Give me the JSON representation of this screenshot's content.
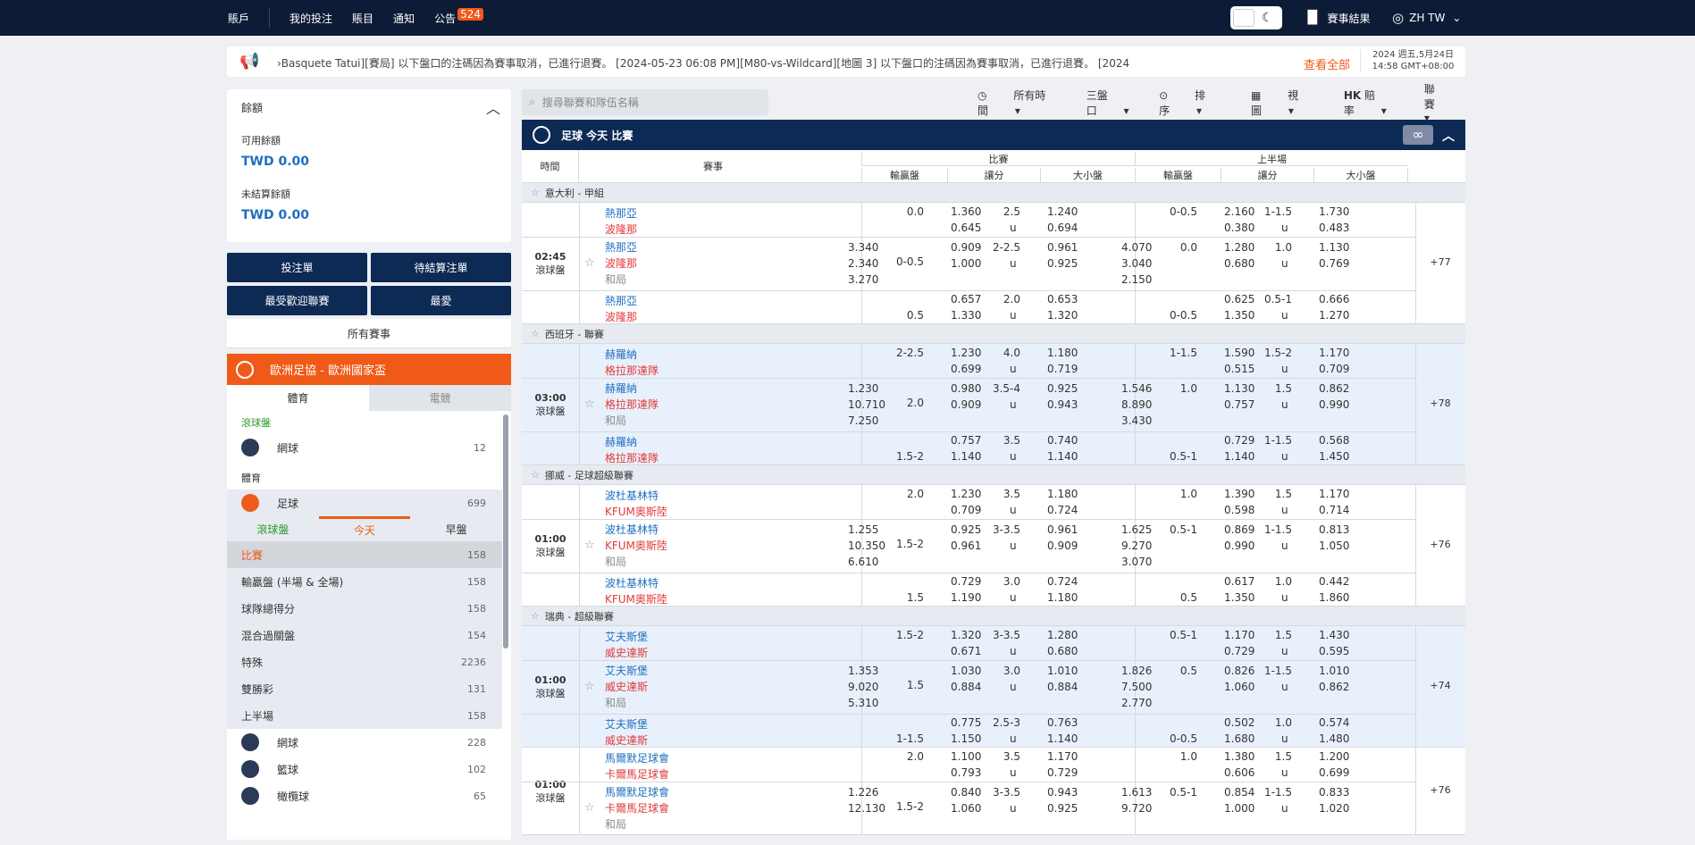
{
  "topbar": {
    "account": "賬戶",
    "my_bets": "我的投注",
    "statement": "賬目",
    "notices": "通知",
    "announce": "公告",
    "announce_badge": "524",
    "results": "賽事結果",
    "lang": "ZH TW"
  },
  "ticker": {
    "text": "›Basquete Tatui][賽局]       以下盤口的注碼因為賽事取消，已進行退賽。 [2024-05-23 06:08 PM][M80-vs-Wildcard][地圖 3]        以下盤口的注碼因為賽事取消，已進行退賽。 [2024",
    "more": "查看全部",
    "date": "2024 週五,5月24日",
    "time": "14:58 GMT+08:00"
  },
  "balance": {
    "title": "餘額",
    "avail_label": "可用餘額",
    "avail": "TWD 0.00",
    "unsettled_label": "未結算餘額",
    "unsettled": "TWD 0.00"
  },
  "buttons": {
    "betslip": "投注單",
    "pending": "待結算注單",
    "popular": "最受歡迎聯賽",
    "fav": "最愛",
    "all": "所有賽事"
  },
  "promo": "歐洲足協 - 歐洲國家盃",
  "sport_tabs": {
    "sports": "體育",
    "esports": "電競"
  },
  "live": {
    "label": "滾球盤",
    "items": [
      {
        "name": "網球",
        "count": "12"
      }
    ]
  },
  "sports": {
    "label": "體育",
    "soccer": "足球",
    "soccer_count": "699"
  },
  "subtabs": {
    "live": "滾球盤",
    "today": "今天",
    "early": "早盤"
  },
  "markets": [
    {
      "name": "比賽",
      "count": "158"
    },
    {
      "name": "輸贏盤 (半場 & 全場)",
      "count": "158"
    },
    {
      "name": "球隊總得分",
      "count": "158"
    },
    {
      "name": "混合過關盤",
      "count": "154"
    },
    {
      "name": "特殊",
      "count": "2236"
    },
    {
      "name": "雙勝彩",
      "count": "131"
    },
    {
      "name": "上半場",
      "count": "158"
    }
  ],
  "other_sports": [
    {
      "name": "網球",
      "count": "228"
    },
    {
      "name": "籃球",
      "count": "102"
    },
    {
      "name": "橄欖球",
      "count": "65"
    }
  ],
  "search_placeholder": "搜尋聯賽和隊伍名稱",
  "filters": {
    "time": "所有時間",
    "lines": "三盤口",
    "sort": "排序",
    "view": "視圖",
    "odds_type": "HK",
    "odds": "賠率",
    "league": "聯賽"
  },
  "section": {
    "title": "足球 今天 比賽",
    "inf": "∞"
  },
  "header": {
    "time": "時間",
    "event": "賽事",
    "full": "比賽",
    "half": "上半場",
    "oneXtwo": "輸贏盤",
    "hdp": "讓分",
    "ou": "大小盤"
  },
  "leagues": [
    {
      "name": "意大利 - 甲組",
      "time": "02:45",
      "live": "滾球盤",
      "more": "+77",
      "home": "熱那亞",
      "away": "波隆那",
      "draw": "和局",
      "r1": {
        "h1": "0.0",
        "o1": "1.360",
        "o2": "0.645",
        "t1": "2.5",
        "u1": "1.240",
        "u2": "0.694",
        "hh": "0-0.5",
        "ho1": "2.160",
        "ho2": "0.380",
        "ht": "1-1.5",
        "hu1": "1.730",
        "hu2": "0.483"
      },
      "r2": {
        "x1": "3.340",
        "x2": "2.340",
        "x3": "3.270",
        "h": "0-0.5",
        "o1": "0.909",
        "o2": "1.000",
        "t": "2-2.5",
        "u1": "0.961",
        "u2": "0.925",
        "hx1": "4.070",
        "hx2": "3.040",
        "hx3": "2.150",
        "hh": "0.0",
        "ho1": "1.280",
        "ho2": "0.680",
        "ht": "1.0",
        "hu1": "1.130",
        "hu2": "0.769"
      },
      "r3": {
        "h": "0.5",
        "o1": "0.657",
        "o2": "1.330",
        "t": "2.0",
        "u1": "0.653",
        "u2": "1.320",
        "hh": "0-0.5",
        "ho1": "0.625",
        "ho2": "1.350",
        "ht": "0.5-1",
        "hu1": "0.666",
        "hu2": "1.270"
      }
    },
    {
      "name": "西班牙 - 聯賽",
      "time": "03:00",
      "live": "滾球盤",
      "more": "+78",
      "home": "赫羅納",
      "away": "格拉那達隊",
      "draw": "和局",
      "r1": {
        "h1": "2-2.5",
        "o1": "1.230",
        "o2": "0.699",
        "t1": "4.0",
        "u1": "1.180",
        "u2": "0.719",
        "hh": "1-1.5",
        "ho1": "1.590",
        "ho2": "0.515",
        "ht": "1.5-2",
        "hu1": "1.170",
        "hu2": "0.709"
      },
      "r2": {
        "x1": "1.230",
        "x2": "10.710",
        "x3": "7.250",
        "h": "2.0",
        "o1": "0.980",
        "o2": "0.909",
        "t": "3.5-4",
        "u1": "0.925",
        "u2": "0.943",
        "hx1": "1.546",
        "hx2": "8.890",
        "hx3": "3.430",
        "hh": "1.0",
        "ho1": "1.130",
        "ho2": "0.757",
        "ht": "1.5",
        "hu1": "0.862",
        "hu2": "0.990"
      },
      "r3": {
        "h": "1.5-2",
        "o1": "0.757",
        "o2": "1.140",
        "t": "3.5",
        "u1": "0.740",
        "u2": "1.140",
        "hh": "0.5-1",
        "ho1": "0.729",
        "ho2": "1.140",
        "ht": "1-1.5",
        "hu1": "0.568",
        "hu2": "1.450"
      }
    },
    {
      "name": "挪威 - 足球超級聯賽",
      "time": "01:00",
      "live": "滾球盤",
      "more": "+76",
      "home": "波杜基林特",
      "away": "KFUM奧斯陸",
      "draw": "和局",
      "r1": {
        "h1": "2.0",
        "o1": "1.230",
        "o2": "0.709",
        "t1": "3.5",
        "u1": "1.180",
        "u2": "0.724",
        "hh": "1.0",
        "ho1": "1.390",
        "ho2": "0.598",
        "ht": "1.5",
        "hu1": "1.170",
        "hu2": "0.714"
      },
      "r2": {
        "x1": "1.255",
        "x2": "10.350",
        "x3": "6.610",
        "h": "1.5-2",
        "o1": "0.925",
        "o2": "0.961",
        "t": "3-3.5",
        "u1": "0.961",
        "u2": "0.909",
        "hx1": "1.625",
        "hx2": "9.270",
        "hx3": "3.070",
        "hh": "0.5-1",
        "ho1": "0.869",
        "ho2": "0.990",
        "ht": "1-1.5",
        "hu1": "0.813",
        "hu2": "1.050"
      },
      "r3": {
        "h": "1.5",
        "o1": "0.729",
        "o2": "1.190",
        "t": "3.0",
        "u1": "0.724",
        "u2": "1.180",
        "hh": "0.5",
        "ho1": "0.617",
        "ho2": "1.350",
        "ht": "1.0",
        "hu1": "0.442",
        "hu2": "1.860"
      }
    },
    {
      "name": "瑞典 - 超級聯賽",
      "time": "01:00",
      "live": "滾球盤",
      "more": "+74",
      "home": "艾夫斯堡",
      "away": "威史達斯",
      "draw": "和局",
      "r1": {
        "h1": "1.5-2",
        "o1": "1.320",
        "o2": "0.671",
        "t1": "3-3.5",
        "u1": "1.280",
        "u2": "0.680",
        "hh": "0.5-1",
        "ho1": "1.170",
        "ho2": "0.729",
        "ht": "1.5",
        "hu1": "1.430",
        "hu2": "0.595"
      },
      "r2": {
        "x1": "1.353",
        "x2": "9.020",
        "x3": "5.310",
        "h": "1.5",
        "o1": "1.030",
        "o2": "0.884",
        "t": "3.0",
        "u1": "1.010",
        "u2": "0.884",
        "hx1": "1.826",
        "hx2": "7.500",
        "hx3": "2.770",
        "hh": "0.5",
        "ho1": "0.826",
        "ho2": "1.060",
        "ht": "1-1.5",
        "hu1": "1.010",
        "hu2": "0.862"
      },
      "r3": {
        "h": "1-1.5",
        "o1": "0.775",
        "o2": "1.150",
        "t": "2.5-3",
        "u1": "0.763",
        "u2": "1.140",
        "hh": "0-0.5",
        "ho1": "0.502",
        "ho2": "1.680",
        "ht": "1.0",
        "hu1": "0.574",
        "hu2": "1.480"
      }
    },
    {
      "name": "",
      "time": "01:00",
      "live": "滾球盤",
      "more": "+76",
      "home": "馬爾默足球會",
      "away": "卡爾馬足球會",
      "draw": "和局",
      "r1": {
        "h1": "2.0",
        "o1": "1.100",
        "o2": "0.793",
        "t1": "3.5",
        "u1": "1.170",
        "u2": "0.729",
        "hh": "1.0",
        "ho1": "1.380",
        "ho2": "0.606",
        "ht": "1.5",
        "hu1": "1.200",
        "hu2": "0.699"
      },
      "r2": {
        "x1": "1.226",
        "x2": "12.130",
        "x3": "",
        "h": "1.5-2",
        "o1": "0.840",
        "o2": "1.060",
        "t": "3-3.5",
        "u1": "0.943",
        "u2": "0.925",
        "hx1": "1.613",
        "hx2": "9.720",
        "hx3": "",
        "hh": "0.5-1",
        "ho1": "0.854",
        "ho2": "1.000",
        "ht": "1-1.5",
        "hu1": "0.833",
        "hu2": "1.020"
      }
    }
  ],
  "u": "u"
}
